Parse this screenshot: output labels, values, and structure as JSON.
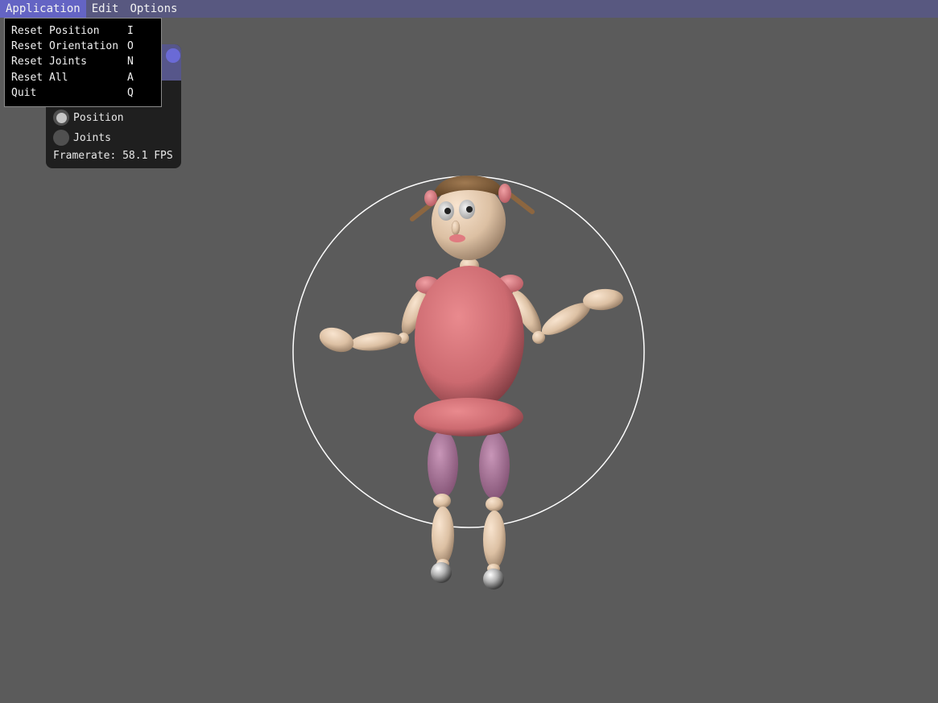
{
  "menubar": {
    "items": [
      {
        "label": "Application"
      },
      {
        "label": "Edit"
      },
      {
        "label": "Options"
      }
    ]
  },
  "application_menu": {
    "items": [
      {
        "label": "Reset Position",
        "shortcut": "I"
      },
      {
        "label": "Reset Orientation",
        "shortcut": "O"
      },
      {
        "label": "Reset Joints",
        "shortcut": "N"
      },
      {
        "label": "Reset All",
        "shortcut": "A"
      },
      {
        "label": "Quit",
        "shortcut": "Q"
      }
    ]
  },
  "panel": {
    "mode_options": [
      {
        "label": "Position",
        "selected": true
      },
      {
        "label": "Joints",
        "selected": false
      }
    ],
    "framerate_text": "Framerate: 58.1 FPS"
  },
  "colors": {
    "background": "#5b5b5b",
    "menubar": "#585880",
    "menu_active": "#6464c4",
    "body_pink": "#d9787c",
    "skin": "#e8ccb0",
    "legs": "#b57aa0",
    "hair": "#8c6640"
  }
}
